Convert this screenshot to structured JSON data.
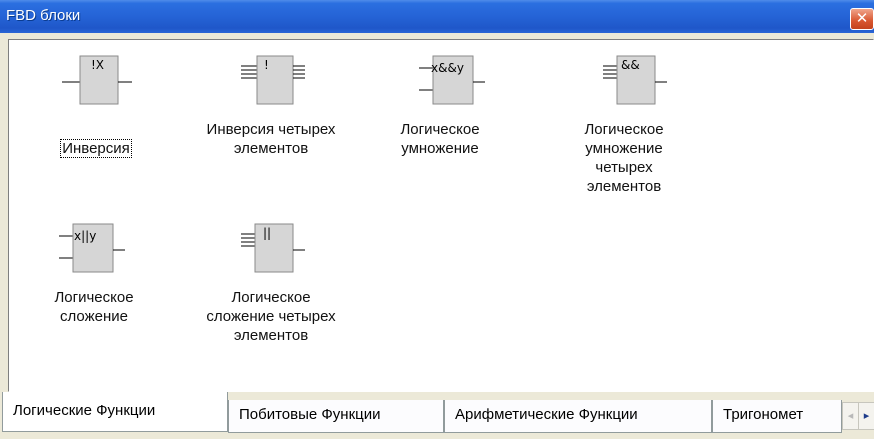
{
  "window": {
    "title": "FBD блоки",
    "close_label": "✕"
  },
  "blocks": [
    {
      "id": "inv",
      "symbol": "!X",
      "label": "Инверсия",
      "selected": true
    },
    {
      "id": "inv4",
      "symbol": "!",
      "label": "Инверсия четырех\nэлементов"
    },
    {
      "id": "and",
      "symbol": "x&&y",
      "label": "Логическое\nумножение"
    },
    {
      "id": "and4",
      "symbol": "&&",
      "label": "Логическое\nумножение\nчетырех\nэлементов"
    },
    {
      "id": "or",
      "symbol": "x||y",
      "label": "Логическое\nсложение"
    },
    {
      "id": "or4",
      "symbol": "||",
      "label": "Логическое\nсложение четырех\nэлементов"
    }
  ],
  "tabs": [
    {
      "label": "Логические Функции",
      "active": true
    },
    {
      "label": "Побитовые Функции"
    },
    {
      "label": "Арифметические Функции"
    },
    {
      "label": "Тригономет"
    }
  ],
  "scroll": {
    "left_icon": "arrow-left-icon",
    "right_icon": "arrow-right-icon",
    "left_glyph": "◂",
    "right_glyph": "▸"
  }
}
